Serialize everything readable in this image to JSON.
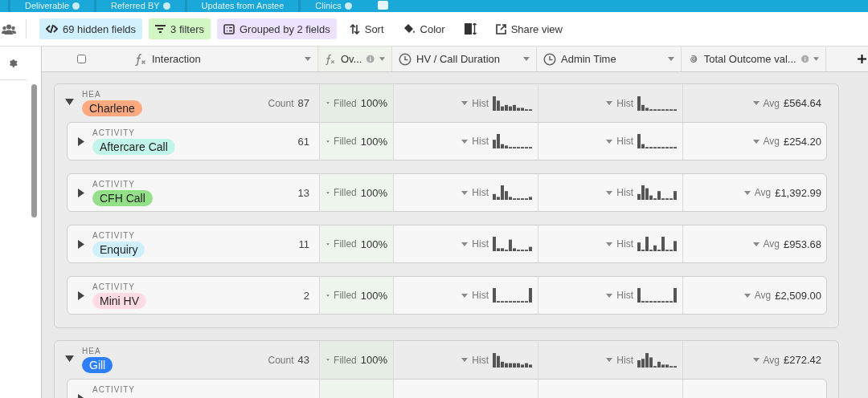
{
  "view_tabs": [
    {
      "label": "Deliverable",
      "info": true
    },
    {
      "label": "Referred BY",
      "info": true
    },
    {
      "label": "Updates from Anstee",
      "info": false
    },
    {
      "label": "Clinics",
      "info": true
    }
  ],
  "toolbar": [
    {
      "kind": "hidden",
      "label": "69 hidden fields",
      "color": "#d0f0fd"
    },
    {
      "kind": "filter",
      "label": "3 filters",
      "color": "#d1f7c4"
    },
    {
      "kind": "group",
      "label": "Grouped by 2 fields",
      "color": "#ede2fe"
    },
    {
      "kind": "sort",
      "label": "Sort"
    },
    {
      "kind": "color",
      "label": "Color"
    },
    {
      "kind": "rowheight"
    },
    {
      "kind": "share",
      "label": "Share view"
    }
  ],
  "select_all": {
    "checked": false
  },
  "columns": [
    {
      "kind": "formula",
      "label": "Interaction",
      "info": false
    },
    {
      "kind": "formula",
      "label": "Ov...",
      "info": true
    },
    {
      "kind": "duration",
      "label": "HV / Call Duration",
      "info": false
    },
    {
      "kind": "duration",
      "label": "Admin Time",
      "info": false
    },
    {
      "kind": "rollup",
      "label": "Total Outcome val...",
      "info": true
    }
  ],
  "groups": [
    {
      "field": "HEA",
      "name": "Charlene",
      "color": "#ffa981",
      "expanded": true,
      "count_label": "Count",
      "count": "87",
      "cells": [
        {
          "kind": "filled",
          "label": "Filled",
          "value": "100%"
        },
        {
          "kind": "hist",
          "label": "Hist"
        },
        {
          "kind": "hist",
          "label": "Hist"
        },
        {
          "kind": "avg",
          "label": "Avg",
          "value": "£564.64"
        }
      ],
      "children": [
        {
          "field": "ACTIVITY",
          "name": "Aftercare Call",
          "color": "#c2f5e9",
          "expanded": false,
          "count": "61",
          "cells": [
            {
              "kind": "filled",
              "label": "Filled",
              "value": "100%"
            },
            {
              "kind": "hist",
              "label": "Hist"
            },
            {
              "kind": "hist",
              "label": "Hist"
            },
            {
              "kind": "avg",
              "label": "Avg",
              "value": "£254.20"
            }
          ]
        },
        {
          "field": "ACTIVITY",
          "name": "CFH Call",
          "color": "#93e088",
          "expanded": false,
          "count": "13",
          "cells": [
            {
              "kind": "filled",
              "label": "Filled",
              "value": "100%"
            },
            {
              "kind": "hist",
              "label": "Hist"
            },
            {
              "kind": "hist",
              "label": "Hist"
            },
            {
              "kind": "avg",
              "label": "Avg",
              "value": "£1,392.99"
            }
          ]
        },
        {
          "field": "ACTIVITY",
          "name": "Enquiry",
          "color": "#d0f0fd",
          "expanded": false,
          "count": "11",
          "cells": [
            {
              "kind": "filled",
              "label": "Filled",
              "value": "100%"
            },
            {
              "kind": "hist",
              "label": "Hist"
            },
            {
              "kind": "hist",
              "label": "Hist"
            },
            {
              "kind": "avg",
              "label": "Avg",
              "value": "£953.68"
            }
          ]
        },
        {
          "field": "ACTIVITY",
          "name": "Mini HV",
          "color": "#ffdce5",
          "expanded": false,
          "count": "2",
          "cells": [
            {
              "kind": "filled",
              "label": "Filled",
              "value": "100%"
            },
            {
              "kind": "hist",
              "label": "Hist"
            },
            {
              "kind": "hist",
              "label": "Hist"
            },
            {
              "kind": "avg",
              "label": "Avg",
              "value": "£2,509.00"
            }
          ]
        }
      ]
    },
    {
      "field": "HEA",
      "name": "Gill",
      "color": "#2d7ff9",
      "expanded": true,
      "count_label": "Count",
      "count": "43",
      "cells": [
        {
          "kind": "filled",
          "label": "Filled",
          "value": "100%"
        },
        {
          "kind": "hist",
          "label": "Hist"
        },
        {
          "kind": "hist",
          "label": "Hist"
        },
        {
          "kind": "avg",
          "label": "Avg",
          "value": "£272.42"
        }
      ],
      "children": [
        {
          "field": "ACTIVITY",
          "expanded": false
        }
      ]
    }
  ]
}
